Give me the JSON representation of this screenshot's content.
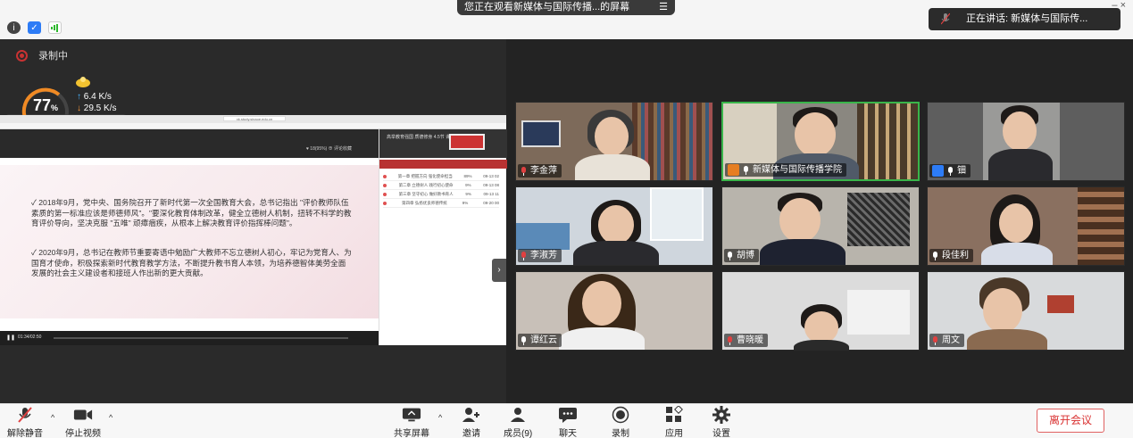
{
  "top": {
    "share_banner": "您正在观看新媒体与国际传播...的屏幕",
    "speaking_label": "正在讲话: 新媒体与国际传...",
    "window_controls": "– ×"
  },
  "recording": {
    "label": "录制中"
  },
  "network": {
    "gauge_value": "77",
    "gauge_unit": "%",
    "upload": "6.4 K/s",
    "download": "29.5 K/s"
  },
  "shared_screen": {
    "url": "xk.study.sinaoe.edu.cn",
    "header_info": "♥ 18(95%)   ⊕ 评论收藏",
    "paragraph1": "✓ 2018年9月，党中央、国务院召开了新时代第一次全国教育大会，总书记指出 \"评价教师队伍素质的第一标准应该是师德师风\"。\"要深化教育体制改革，健全立德树人机制，扭转不科学的教育评价导向，坚决克服 \"五唯\" 顽瘴痼疾，从根本上解决教育评价指挥棒问题\"。",
    "paragraph2": "✓ 2020年9月，总书记在教师节重要寄语中勉励广大教师不忘立德树人初心，牢记为党育人、为国育才使命，积极探索新时代教育教学方法，不断提升教书育人本领，为培养德智体美劳全面发展的社会主义建设者和接班人作出新的更大贡献。",
    "player_time": "01:34/02:50",
    "side_header": "高举教育强国 质德修身 4.5节 课程 · 完成",
    "side_rows": [
      {
        "title": "第一章 把握方向 强化使命担当",
        "pct": "89%",
        "date": "09-13 02"
      },
      {
        "title": "第二章 立德树人 践行初心使命",
        "pct": "9%",
        "date": "09-13 08"
      },
      {
        "title": "第三章 坚守初心 做好教书育人",
        "pct": "9%",
        "date": "09-13 11"
      },
      {
        "title": "第四章 弘扬优良师德传统",
        "pct": "9%",
        "date": "09-20 00"
      }
    ]
  },
  "participants": [
    {
      "name": "李金萍",
      "muted": true,
      "badge": "none"
    },
    {
      "name": "新媒体与国际传播学院",
      "muted": false,
      "badge": "host",
      "active": true
    },
    {
      "name": "钿",
      "muted": false,
      "badge": "user"
    },
    {
      "name": "李淑芳",
      "muted": true,
      "badge": "none"
    },
    {
      "name": "胡博",
      "muted": false,
      "badge": "none"
    },
    {
      "name": "段佳利",
      "muted": false,
      "badge": "none"
    },
    {
      "name": "谭红云",
      "muted": false,
      "badge": "none"
    },
    {
      "name": "曹晓暖",
      "muted": true,
      "badge": "none"
    },
    {
      "name": "周文",
      "muted": true,
      "badge": "none"
    }
  ],
  "toolbar": {
    "unmute": "解除静音",
    "stop_video": "停止视频",
    "share_screen": "共享屏幕",
    "invite": "邀请",
    "members": "成员(9)",
    "chat": "聊天",
    "record": "录制",
    "apps": "应用",
    "settings": "设置",
    "leave": "离开会议"
  },
  "colors": {
    "accent_red": "#d93030",
    "active_border": "#39b54a",
    "stage_bg": "#232323"
  }
}
